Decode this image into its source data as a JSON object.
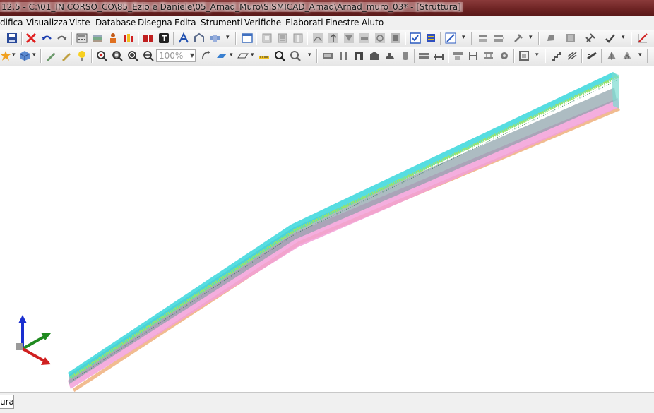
{
  "window": {
    "title": "12.5 - C:\\01_IN CORSO_CO\\85_Ezio e Daniele\\05_Arnad_Muro\\SISMICAD_Arnad\\Arnad_muro_03* - [Struttura]"
  },
  "menu": {
    "items": [
      "difica",
      "Visualizza",
      "Viste",
      "Database",
      "Disegna",
      "Edita",
      "Strumenti",
      "Verifiche",
      "Elaborati",
      "Finestre",
      "Aiuto"
    ]
  },
  "toolbar2": {
    "zoom_placeholder": "100%"
  },
  "status": {
    "tab_label": "ura"
  },
  "colors": {
    "titlebar": "#6d2323",
    "beam_top": "#38d7dc",
    "beam_rebar": "#9be36a",
    "beam_bottom": "#f2a0d8",
    "foundation": "#f0b88a",
    "axis_z": "#1a2fd0",
    "axis_y": "#1f8a1f",
    "axis_x": "#d02020"
  }
}
